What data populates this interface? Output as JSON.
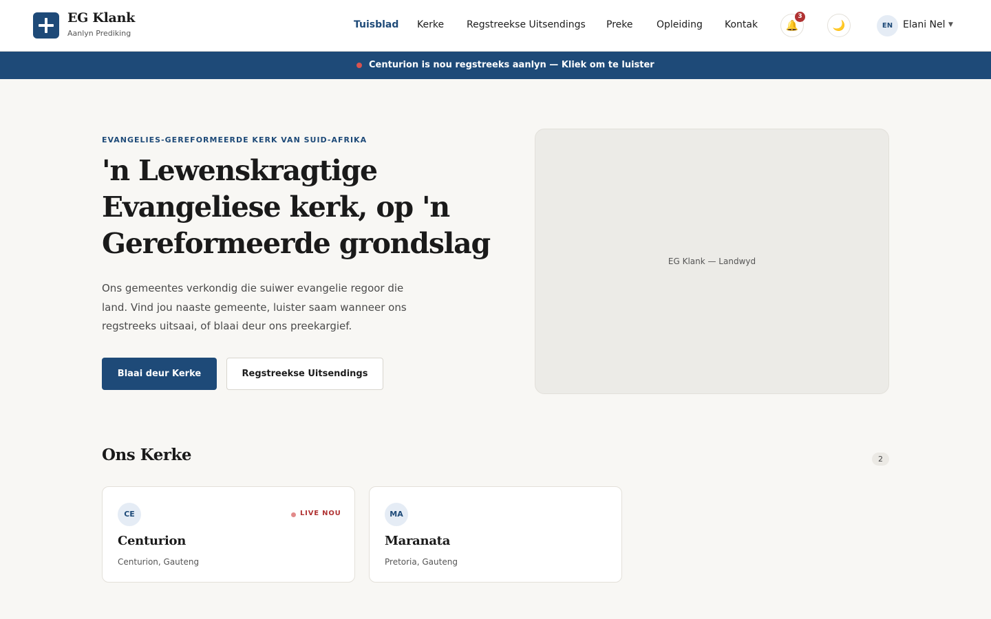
{
  "brand": {
    "name": "EG Klank",
    "tagline": "Aanlyn Prediking",
    "logo_icon": "cross-icon"
  },
  "nav": [
    {
      "label": "Tuisblad",
      "active": true
    },
    {
      "label": "Kerke",
      "active": false
    },
    {
      "label": "Regstreekse Uitsendings",
      "active": false
    },
    {
      "label": "Preke",
      "active": false
    },
    {
      "label": "Opleiding",
      "active": false
    },
    {
      "label": "Kontak",
      "active": false
    }
  ],
  "notifications": {
    "count": "3",
    "icon": "bell-icon"
  },
  "theme_toggle": {
    "icon": "moon-icon"
  },
  "language": "EN",
  "user": {
    "name": "Elani Nel"
  },
  "live_banner": {
    "text": "Centurion is nou regstreeks aanlyn — Kliek om te luister"
  },
  "hero": {
    "eyebrow": "EVANGELIES-GEREFORMEERDE KERK VAN SUID-AFRIKA",
    "title": "'n Lewenskragtige Evangeliese kerk, op 'n Gereformeerde grondslag",
    "description": "Ons gemeentes verkondig die suiwer evangelie regoor die land. Vind jou naaste gemeente, luister saam wanneer ons regstreeks uitsaai, of blaai deur ons preekargief.",
    "primary_button": "Blaai deur Kerke",
    "secondary_button": "Regstreekse Uitsendings",
    "image_caption": "EG Klank — Landwyd"
  },
  "churches": {
    "title": "Ons Kerke",
    "count": "2",
    "items": [
      {
        "initials": "CE",
        "name": "Centurion",
        "location": "Centurion, Gauteng",
        "live_label": "LIVE NOU"
      },
      {
        "initials": "MA",
        "name": "Maranata",
        "location": "Pretoria, Gauteng"
      }
    ]
  },
  "colors": {
    "primary": "#1e4a78",
    "live": "#b03232",
    "background": "#f8f7f4"
  }
}
